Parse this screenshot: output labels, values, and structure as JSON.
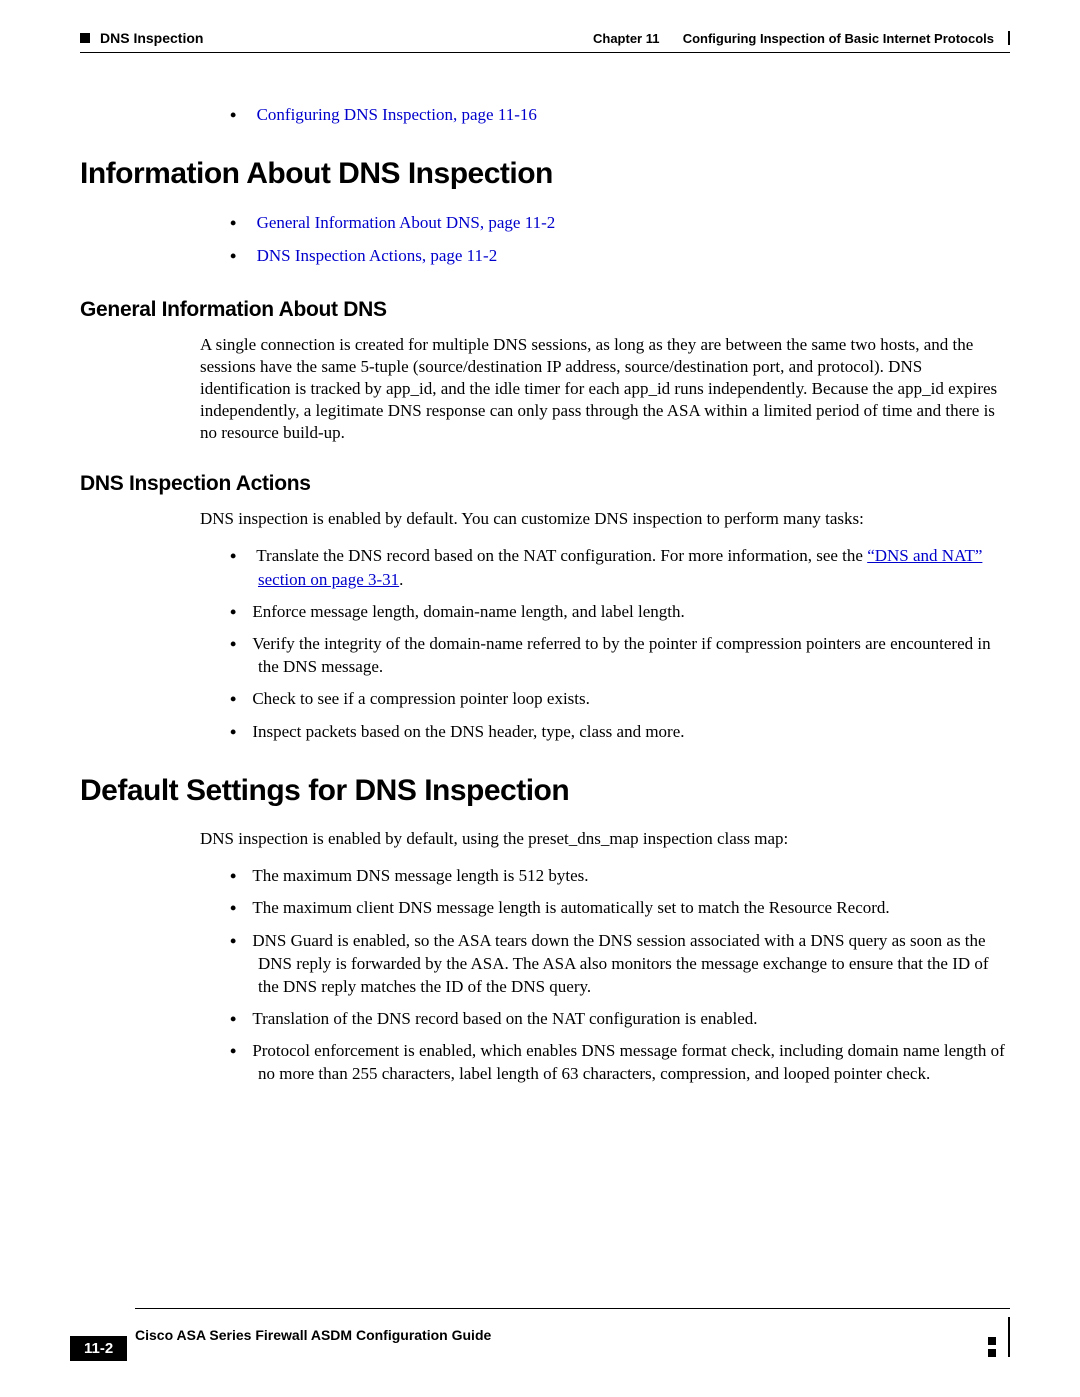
{
  "header": {
    "section_label": "DNS Inspection",
    "chapter_label": "Chapter 11",
    "chapter_title": "Configuring Inspection of Basic Internet Protocols"
  },
  "top_bullets": [
    {
      "text": "Configuring DNS Inspection, page 11-16",
      "link": true
    }
  ],
  "h1_info": "Information About DNS Inspection",
  "info_bullets": [
    {
      "text": "General Information About DNS, page 11-2",
      "link": true
    },
    {
      "text": "DNS Inspection Actions, page 11-2",
      "link": true
    }
  ],
  "h2_general": "General Information About DNS",
  "p_general": "A single connection is created for multiple DNS sessions, as long as they are between the same two hosts, and the sessions have the same 5-tuple (source/destination IP address, source/destination port, and protocol). DNS identification is tracked by app_id, and the idle timer for each app_id runs independently. Because the app_id expires independently, a legitimate DNS response can only pass through the ASA within a limited period of time and there is no resource build-up.",
  "h2_actions": "DNS Inspection Actions",
  "p_actions_intro": "DNS inspection is enabled by default. You can customize DNS inspection to perform many tasks:",
  "actions_bullets": {
    "b1_pre": "Translate the DNS record based on the NAT configuration. For more information, see the ",
    "b1_link": "“DNS and NAT” section on page 3-31",
    "b1_post": ".",
    "b2": "Enforce message length, domain-name length, and label length.",
    "b3": "Verify the integrity of the domain-name referred to by the pointer if compression pointers are encountered in the DNS message.",
    "b4": "Check to see if a compression pointer loop exists.",
    "b5": "Inspect packets based on the DNS header, type, class and more."
  },
  "h1_defaults": "Default Settings for DNS Inspection",
  "p_defaults_intro": "DNS inspection is enabled by default, using the preset_dns_map inspection class map:",
  "defaults_bullets": {
    "d1": "The maximum DNS message length is 512 bytes.",
    "d2": "The maximum client DNS message length is automatically set to match the Resource Record.",
    "d3": "DNS Guard is enabled, so the ASA tears down the DNS session associated with a DNS query as soon as the DNS reply is forwarded by the ASA. The ASA also monitors the message exchange to ensure that the ID of the DNS reply matches the ID of the DNS query.",
    "d4": "Translation of the DNS record based on the NAT configuration is enabled.",
    "d5": "Protocol enforcement is enabled, which enables DNS message format check, including domain name length of no more than 255 characters, label length of 63 characters, compression, and looped pointer check."
  },
  "footer": {
    "guide_title": "Cisco ASA Series Firewall ASDM Configuration Guide",
    "page_number": "11-2"
  }
}
